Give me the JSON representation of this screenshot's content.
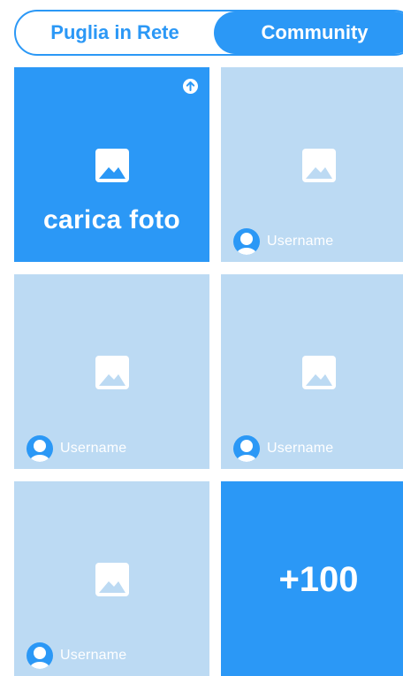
{
  "tabs": [
    {
      "label": "Puglia in Rete",
      "active": false
    },
    {
      "label": "Community",
      "active": true
    }
  ],
  "upload_tile": {
    "label": "carica foto",
    "icon": "upload-arrow-icon"
  },
  "photos": [
    {
      "username": "Username"
    },
    {
      "username": "Username"
    },
    {
      "username": "Username"
    },
    {
      "username": "Username"
    }
  ],
  "more_tile": {
    "label": "+100"
  },
  "colors": {
    "accent": "#2b98f6",
    "tile_bg": "#bcdaf3"
  }
}
